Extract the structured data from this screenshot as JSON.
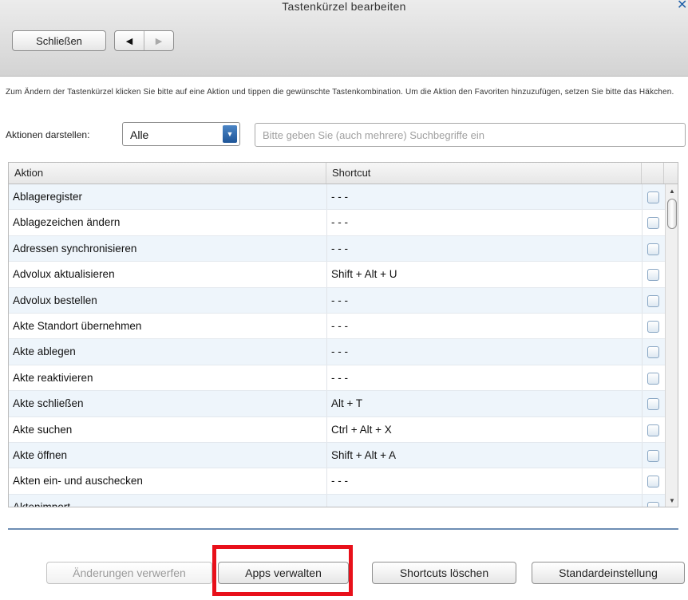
{
  "window": {
    "title": "Tastenkürzel bearbeiten",
    "close_icon": "✕"
  },
  "toolbar": {
    "close_label": "Schließen",
    "back_icon": "◀",
    "forward_icon": "▶"
  },
  "description": "Zum Ändern der Tastenkürzel klicken Sie bitte auf eine Aktion und tippen die gewünschte Tastenkombination. Um die Aktion den Favoriten hinzuzufügen, setzen Sie bitte das Häkchen.",
  "filter": {
    "label": "Aktionen darstellen:",
    "selected": "Alle",
    "dropdown_icon": "▼",
    "search_placeholder": "Bitte geben Sie (auch mehrere) Suchbegriffe ein",
    "search_value": ""
  },
  "table": {
    "columns": [
      "Aktion",
      "Shortcut"
    ],
    "rows": [
      {
        "action": "Ablageregister",
        "shortcut": "- - -",
        "favorite": false
      },
      {
        "action": "Ablagezeichen ändern",
        "shortcut": "- - -",
        "favorite": false
      },
      {
        "action": "Adressen synchronisieren",
        "shortcut": "- - -",
        "favorite": false
      },
      {
        "action": "Advolux aktualisieren",
        "shortcut": "Shift + Alt + U",
        "favorite": false
      },
      {
        "action": "Advolux bestellen",
        "shortcut": "- - -",
        "favorite": false
      },
      {
        "action": "Akte Standort übernehmen",
        "shortcut": "- - -",
        "favorite": false
      },
      {
        "action": "Akte ablegen",
        "shortcut": "- - -",
        "favorite": false
      },
      {
        "action": "Akte reaktivieren",
        "shortcut": "- - -",
        "favorite": false
      },
      {
        "action": "Akte schließen",
        "shortcut": "Alt + T",
        "favorite": false
      },
      {
        "action": "Akte suchen",
        "shortcut": "Ctrl + Alt + X",
        "favorite": false
      },
      {
        "action": "Akte öffnen",
        "shortcut": "Shift + Alt + A",
        "favorite": false
      },
      {
        "action": "Akten ein- und auschecken",
        "shortcut": "- - -",
        "favorite": false
      },
      {
        "action": "Aktenimport",
        "shortcut": "",
        "favorite": false
      }
    ]
  },
  "footer": {
    "discard_label": "Änderungen verwerfen",
    "apps_label": "Apps verwalten",
    "clear_label": "Shortcuts löschen",
    "defaults_label": "Standardeinstellung"
  },
  "colors": {
    "highlight": "#e8101a",
    "accent": "#1e5598"
  }
}
